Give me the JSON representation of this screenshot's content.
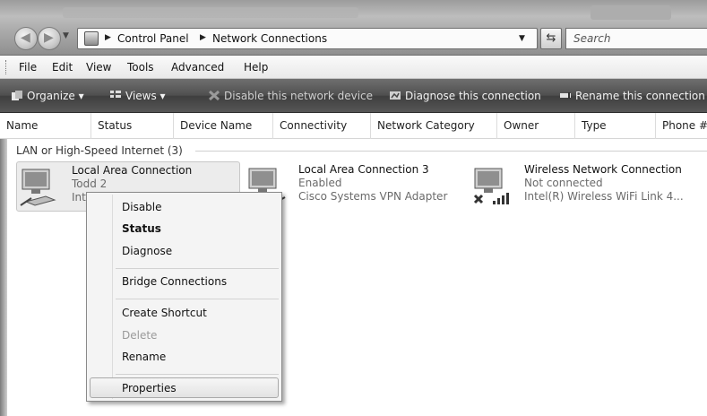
{
  "window": {
    "address": [
      "Control Panel",
      "Network Connections"
    ],
    "search_placeholder": "Search",
    "refresh_glyph": "⇆"
  },
  "menubar": {
    "items": [
      "File",
      "Edit",
      "View",
      "Tools",
      "Advanced",
      "Help"
    ]
  },
  "commandbar": {
    "organize": "Organize ▾",
    "views": "Views ▾",
    "disable": "Disable this network device",
    "diagnose": "Diagnose this connection",
    "rename": "Rename this connection"
  },
  "columns": [
    "Name",
    "Status",
    "Device Name",
    "Connectivity",
    "Network Category",
    "Owner",
    "Type",
    "Phone #"
  ],
  "group": {
    "label": "LAN or High-Speed Internet (3)"
  },
  "connections": [
    {
      "name": "Local Area Connection",
      "status": "Todd  2",
      "device": "Int"
    },
    {
      "name": "Local Area Connection 3",
      "status": "Enabled",
      "device": "Cisco Systems VPN Adapter"
    },
    {
      "name": "Wireless Network Connection",
      "status": "Not connected",
      "device": "Intel(R) Wireless WiFi Link 4..."
    }
  ],
  "context_menu": {
    "disable": "Disable",
    "status": "Status",
    "diagnose": "Diagnose",
    "bridge": "Bridge Connections",
    "shortcut": "Create Shortcut",
    "delete": "Delete",
    "rename": "Rename",
    "properties": "Properties"
  }
}
